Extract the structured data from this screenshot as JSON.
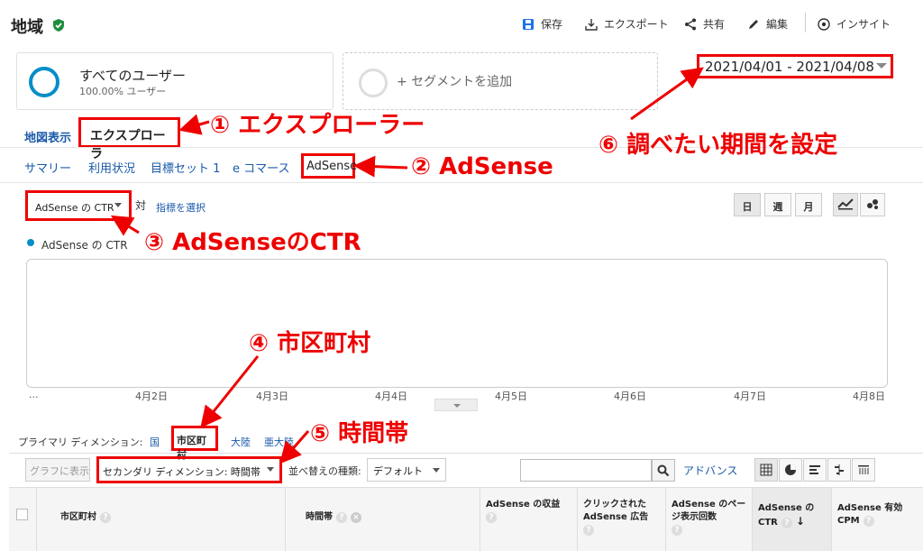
{
  "header": {
    "title": "地域",
    "actions": [
      {
        "label": "保存",
        "icon": "save-icon"
      },
      {
        "label": "エクスポート",
        "icon": "export-icon"
      },
      {
        "label": "共有",
        "icon": "share-icon"
      },
      {
        "label": "編集",
        "icon": "edit-icon"
      },
      {
        "label": "インサイト",
        "icon": "insights-icon"
      }
    ]
  },
  "segments": {
    "current_name": "すべてのユーザー",
    "current_sub": "100.00% ユーザー",
    "add_label": "+ セグメントを追加"
  },
  "date_range": "2021/04/01 - 2021/04/08",
  "view_tabs": {
    "map": "地図表示",
    "explorer": "エクスプローラ"
  },
  "sub_tabs": [
    "サマリー",
    "利用状況",
    "目標セット 1",
    "e コマース",
    "AdSense"
  ],
  "metric": {
    "selected": "AdSense の CTR",
    "vs": "対",
    "select_metric": "指標を選択",
    "legend": "AdSense の CTR"
  },
  "time_toggle": [
    "日",
    "週",
    "月"
  ],
  "chart_data": {
    "type": "line",
    "x": [
      "...",
      "4月2日",
      "4月3日",
      "4月4日",
      "4月5日",
      "4月6日",
      "4月7日",
      "4月8日"
    ],
    "series": [
      {
        "name": "AdSense の CTR",
        "values": []
      }
    ]
  },
  "primary_dimension": {
    "label": "プライマリ ディメンション:",
    "options": [
      "国",
      "市区町村",
      "大陸",
      "亜大陸"
    ],
    "active": "市区町村"
  },
  "table_toolbar": {
    "graph_button": "グラフに表示",
    "secondary_dimension": "セカンダリ ディメンション: 時間帯",
    "sort_label": "並べ替えの種類:",
    "sort_value": "デフォルト",
    "search_placeholder": "",
    "advanced": "アドバンス"
  },
  "table_columns": [
    "市区町村",
    "時間帯",
    "AdSense の収益",
    "クリックされた AdSense 広告",
    "AdSense のページ表示回数",
    "AdSense の CTR",
    "AdSense 有効 CPM"
  ],
  "annotations": [
    "① エクスプローラー",
    "② AdSense",
    "③ AdSenseのCTR",
    "④ 市区町村",
    "⑤ 時間帯",
    "⑥ 調べたい期間を設定"
  ],
  "colors": {
    "accent": "#058dc7",
    "link": "#1a5aa9",
    "annotation": "#e00000",
    "verified": "#1e8e3e"
  }
}
